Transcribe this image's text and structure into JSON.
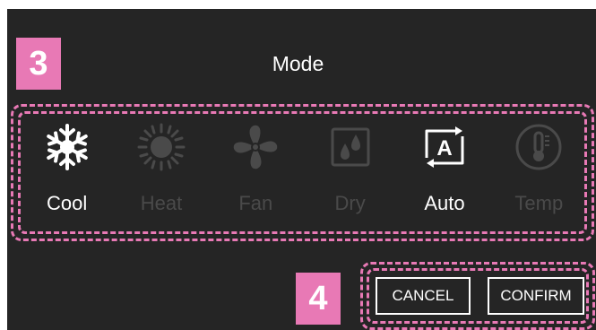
{
  "callouts": {
    "mode_step": "3",
    "buttons_step": "4"
  },
  "header": {
    "title": "Mode"
  },
  "modes": [
    {
      "label": "Cool",
      "icon": "snowflake-icon",
      "enabled": true
    },
    {
      "label": "Heat",
      "icon": "sun-icon",
      "enabled": false
    },
    {
      "label": "Fan",
      "icon": "fan-icon",
      "enabled": false
    },
    {
      "label": "Dry",
      "icon": "water-drops-icon",
      "enabled": false
    },
    {
      "label": "Auto",
      "icon": "auto-mode-icon",
      "enabled": true
    },
    {
      "label": "Temp",
      "icon": "thermometer-icon",
      "enabled": false
    }
  ],
  "actions": {
    "cancel_label": "CANCEL",
    "confirm_label": "CONFIRM"
  },
  "colors": {
    "background": "#252525",
    "callout": "#e879b5",
    "active": "#ffffff",
    "inactive": "#4a4a4a"
  }
}
